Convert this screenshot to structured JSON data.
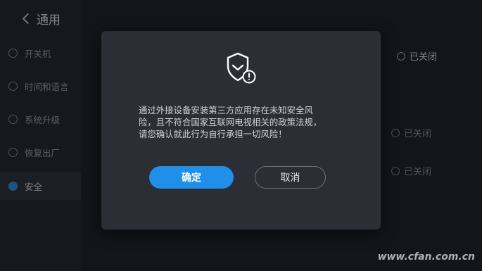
{
  "header": {
    "title": "通用"
  },
  "sidebar": {
    "items": [
      {
        "label": "开关机",
        "icon": "power-icon"
      },
      {
        "label": "时间和语言",
        "icon": "clock-icon"
      },
      {
        "label": "系统升级",
        "icon": "upgrade-icon"
      },
      {
        "label": "恢复出厂",
        "icon": "restore-icon"
      },
      {
        "label": "安全",
        "icon": "security-icon",
        "active": true
      }
    ]
  },
  "content": {
    "rows": [
      {
        "status": "已关闭"
      },
      {
        "status": "已关闭"
      },
      {
        "status": "已关闭"
      }
    ]
  },
  "dialog": {
    "icon": "shield-warning-icon",
    "message_lines": [
      "通过外接设备安装第三方应用存在未知安全风",
      "险，且不符合国家互联网电视相关的政策法规，",
      "请您确认就此行为自行承担一切风险！"
    ],
    "confirm_label": "确定",
    "cancel_label": "取消"
  },
  "watermark": "www.cfan.com.cn",
  "colors": {
    "accent": "#1f8fe8",
    "dialog_bg": "#2b2e35",
    "page_bg": "#1b1e23"
  }
}
